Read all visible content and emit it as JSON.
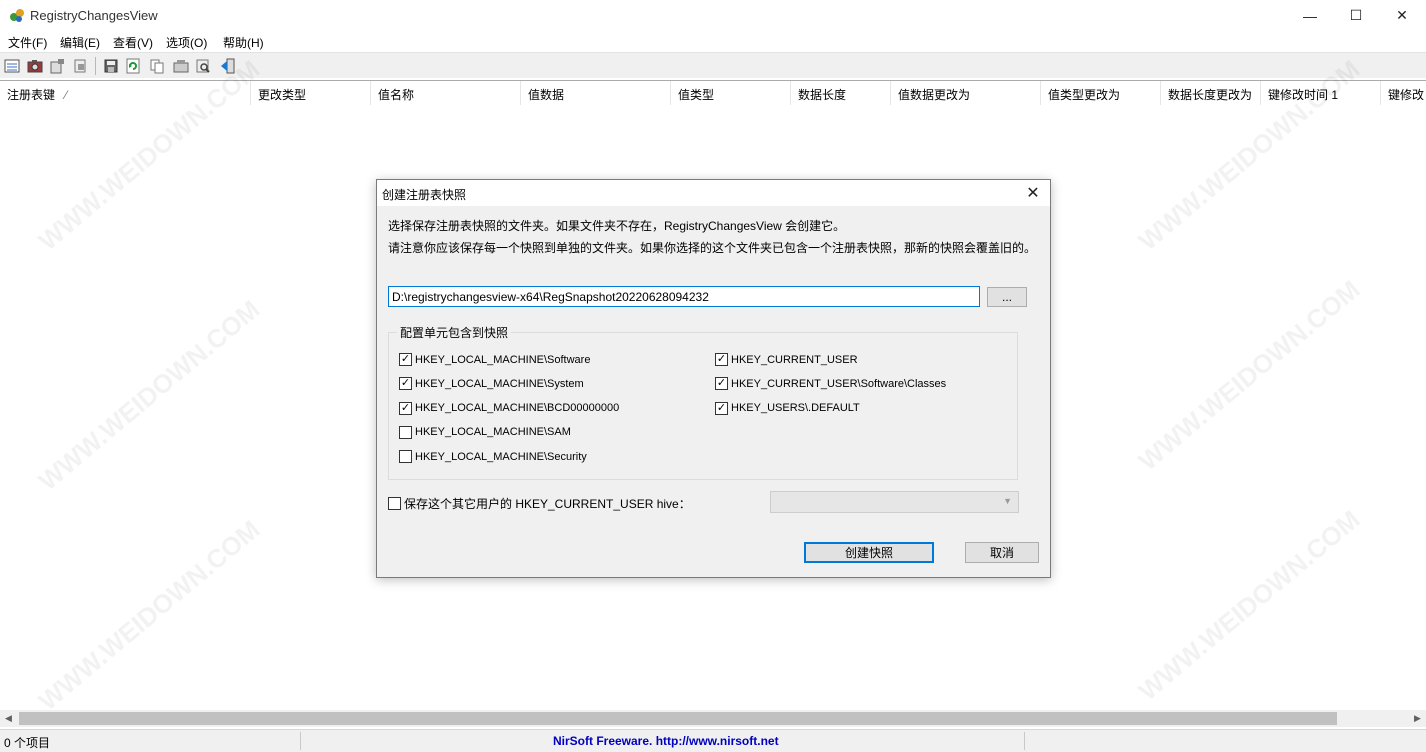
{
  "window": {
    "title": "RegistryChangesView",
    "minimize_glyph": "—",
    "maximize_glyph": "☐",
    "close_glyph": "✕"
  },
  "menu": [
    "文件(F)",
    "编辑(E)",
    "查看(V)",
    "选项(O)",
    "帮助(H)"
  ],
  "toolbar_icons": [
    "properties-icon",
    "camera-icon",
    "export-icon",
    "import-icon",
    "save-icon",
    "refresh-icon",
    "copy-icon",
    "html-report-icon",
    "find-icon",
    "exit-icon"
  ],
  "columns": [
    "注册表键",
    "更改类型",
    "值名称",
    "值数据",
    "值类型",
    "数据长度",
    "值数据更改为",
    "值类型更改为",
    "数据长度更改为",
    "键修改时间 1",
    "键修改"
  ],
  "sort_indicator": "⁄",
  "status": {
    "count": "0 个项目",
    "credit": "NirSoft Freeware.  http://www.nirsoft.net",
    "credit_color": "#0000c0"
  },
  "dialog": {
    "title": "创建注册表快照",
    "close_glyph": "✕",
    "line1": "选择保存注册表快照的文件夹。如果文件夹不存在，RegistryChangesView 会创建它。",
    "line2": "请注意你应该保存每一个快照到单独的文件夹。如果你选择的这个文件夹已包含一个注册表快照，那新的快照会覆盖旧的。",
    "path_value": "D:\\registrychangesview-x64\\RegSnapshot20220628094232",
    "browse_label": "...",
    "group_label": "配置单元包含到快照",
    "hives_left": [
      {
        "label": "HKEY_LOCAL_MACHINE\\Software",
        "checked": true
      },
      {
        "label": "HKEY_LOCAL_MACHINE\\System",
        "checked": true
      },
      {
        "label": "HKEY_LOCAL_MACHINE\\BCD00000000",
        "checked": true
      },
      {
        "label": "HKEY_LOCAL_MACHINE\\SAM",
        "checked": false
      },
      {
        "label": "HKEY_LOCAL_MACHINE\\Security",
        "checked": false
      }
    ],
    "hives_right": [
      {
        "label": "HKEY_CURRENT_USER",
        "checked": true
      },
      {
        "label": "HKEY_CURRENT_USER\\Software\\Classes",
        "checked": true
      },
      {
        "label": "HKEY_USERS\\.DEFAULT",
        "checked": true
      }
    ],
    "other_user_label": "保存这个其它用户的 HKEY_CURRENT_USER hive：",
    "other_user_checked": false,
    "combo_value": "",
    "create_button": "创建快照",
    "cancel_button": "取消",
    "accent_color": "#0078d7"
  },
  "watermark_text": "WWW.WEIDOWN.COM"
}
